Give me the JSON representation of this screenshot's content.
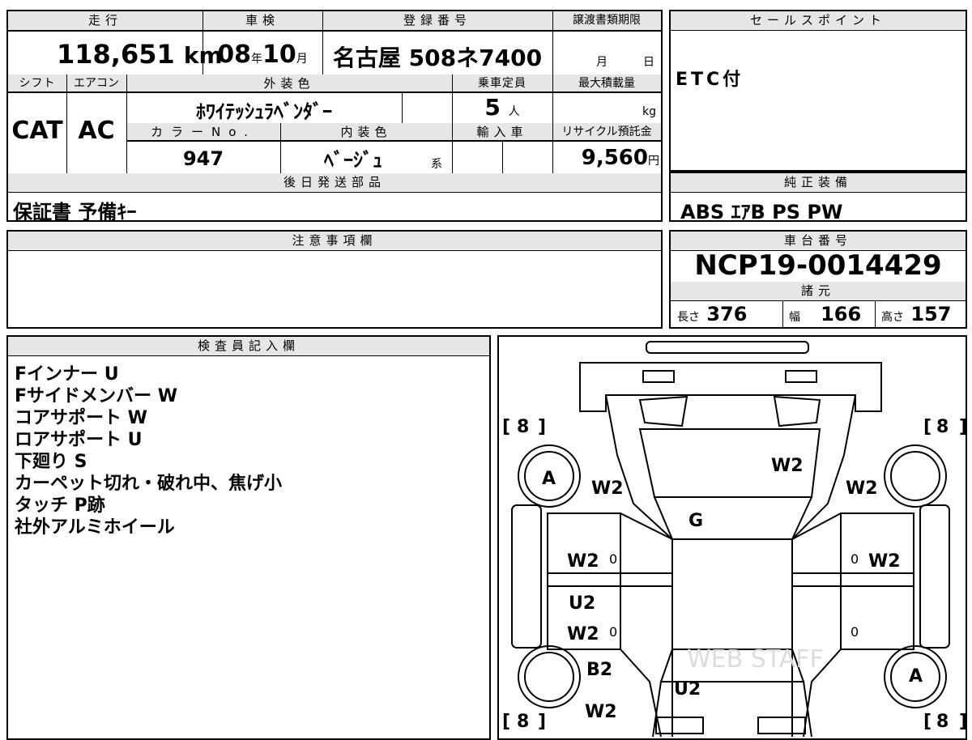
{
  "main": {
    "mileage_header": "走行",
    "mileage_value": "118,651",
    "mileage_unit": "km",
    "inspection_header": "車検",
    "inspection_year": "08",
    "inspection_year_unit": "年",
    "inspection_month": "10",
    "inspection_month_unit": "月",
    "registration_header": "登録番号",
    "registration_value": "名古屋 508ネ7400",
    "transfer_header": "譲渡書類期限",
    "transfer_month_unit": "月",
    "transfer_day_unit": "日",
    "shift_header": "シフト",
    "shift_value": "CAT",
    "ac_header": "エアコン",
    "ac_value": "AC",
    "exterior_color_header": "外装色",
    "exterior_color_value": "ﾎﾜｲﾃｯｼｭﾗﾍﾞﾝﾀﾞｰ",
    "capacity_header": "乗車定員",
    "capacity_value": "5",
    "capacity_unit": "人",
    "max_load_header": "最大積載量",
    "max_load_unit": "kg",
    "color_no_header": "カラーNo.",
    "color_no_value": "947",
    "interior_color_header": "内装色",
    "interior_color_value": "ﾍﾞｰｼﾞｭ",
    "interior_color_suffix": "系",
    "import_header": "輸入車",
    "recycle_header": "リサイクル預託金",
    "recycle_value": "9,560",
    "recycle_unit": "円",
    "later_parts_header": "後日発送部品",
    "later_parts_value": "保証書 予備ｷｰ"
  },
  "sales_point": {
    "header": "セールスポイント",
    "value": "ETC付"
  },
  "genuine_equipment": {
    "header": "純正装備",
    "value": "ABS ｴｱB PS PW"
  },
  "notes": {
    "header": "注意事項欄"
  },
  "chassis": {
    "header": "車台番号",
    "value": "NCP19-0014429"
  },
  "specs": {
    "header": "諸元",
    "length_label": "長さ",
    "length_value": "376",
    "width_label": "幅",
    "width_value": "166",
    "height_label": "高さ",
    "height_value": "157"
  },
  "inspector": {
    "header": "検査員記入欄",
    "lines": [
      "Fインナー U",
      "Fサイドメンバー W",
      "コアサポート W",
      "ロアサポート U",
      "下廻り S",
      "カーペット切れ・破れ中、焦げ小",
      "タッチ P跡",
      "社外アルミホイール"
    ]
  },
  "diagram": {
    "tire_fl": "8",
    "tire_fr": "8",
    "tire_rl": "8",
    "tire_rr": "8",
    "wheel_fl": "A",
    "wheel_rr": "A",
    "hood": "W2",
    "fender_left": "W2",
    "fender_right": "W2",
    "windshield": "G",
    "front_door_left": "W2",
    "front_door_right": "W2",
    "pillar_left": "U2",
    "rear_door_left": "W2",
    "rear_fender_left": "B2",
    "roof_rear": "U2",
    "rear_quarter_left": "W2",
    "zero_a": "0",
    "zero_b": "0",
    "zero_c": "0",
    "zero_d": "0",
    "watermark": "WEB STAFF"
  }
}
